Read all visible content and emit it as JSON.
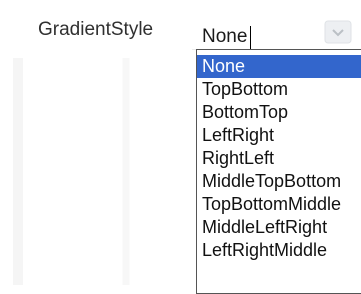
{
  "property": {
    "label": "GradientStyle"
  },
  "combo": {
    "value": "None",
    "button_icon": "dropdown-arrow-icon"
  },
  "dropdown": {
    "selected_index": 0,
    "options": [
      "None",
      "TopBottom",
      "BottomTop",
      "LeftRight",
      "RightLeft",
      "MiddleTopBottom",
      "TopBottomMiddle",
      "MiddleLeftRight",
      "LeftRightMiddle"
    ]
  },
  "colors": {
    "selection": "#3366cc",
    "list_border": "#555555",
    "text": "#111111"
  }
}
